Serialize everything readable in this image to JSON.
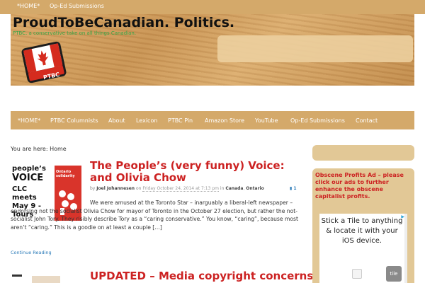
{
  "topbar": {
    "items": [
      "*HOME*",
      "Op-Ed Submissions"
    ]
  },
  "header": {
    "title": "ProudToBeCanadian. Politics.",
    "tagline": "PTBC. a conservative take on all things Canadian.",
    "pin_text": "PTBC"
  },
  "nav": {
    "items": [
      "*HOME*",
      "PTBC Columnists",
      "About",
      "Lexicon",
      "PTBC Pin",
      "Amazon Store",
      "YouTube",
      "Op-Ed Submissions",
      "Contact"
    ]
  },
  "breadcrumb": "You are here: Home",
  "posts": [
    {
      "title": "The People’s (very funny) Voice: and Olivia Chow",
      "by": "by",
      "author": "Joel Johannesen",
      "on": "on",
      "date": "Friday October 24, 2014 at 7:13 pm",
      "in": "in",
      "cat1": "Canada",
      "cat2": "Ontario",
      "comments": "1",
      "excerpt": "We were amused at the Toronto Star – inarguably a liberal-left newspaper – endorsing not the socialist Olivia Chow for mayor of Toronto in the October 27 election, but rather the not-socialist John Tory. They risibly describe Tory as a “caring conservative.” You know, “caring”, because most aren’t “caring.” This is a goodie on at least a couple […]",
      "read_more": "Continue Reading",
      "thumb": {
        "line1": "people’s",
        "line2": "VOICE",
        "line3": "CLC",
        "line4": "meets",
        "line5": "May 9 -",
        "line6": "Tours",
        "tag": "Ontario solidarity"
      }
    },
    {
      "title": "UPDATED – Media copyright concerns,"
    }
  ],
  "sidebar": {
    "ad_title": "Obscene Profits Ad – please click our ads to further enhance the obscene capitalist profits.",
    "tile_ad": {
      "text": "Stick a Tile to anything & locate it with your iOS device.",
      "logo": "tile"
    }
  },
  "colors": {
    "accent_bar": "#d4a96a",
    "title_red": "#cc2222",
    "link_blue": "#2a7ab8",
    "tagline_green": "#37a346"
  }
}
